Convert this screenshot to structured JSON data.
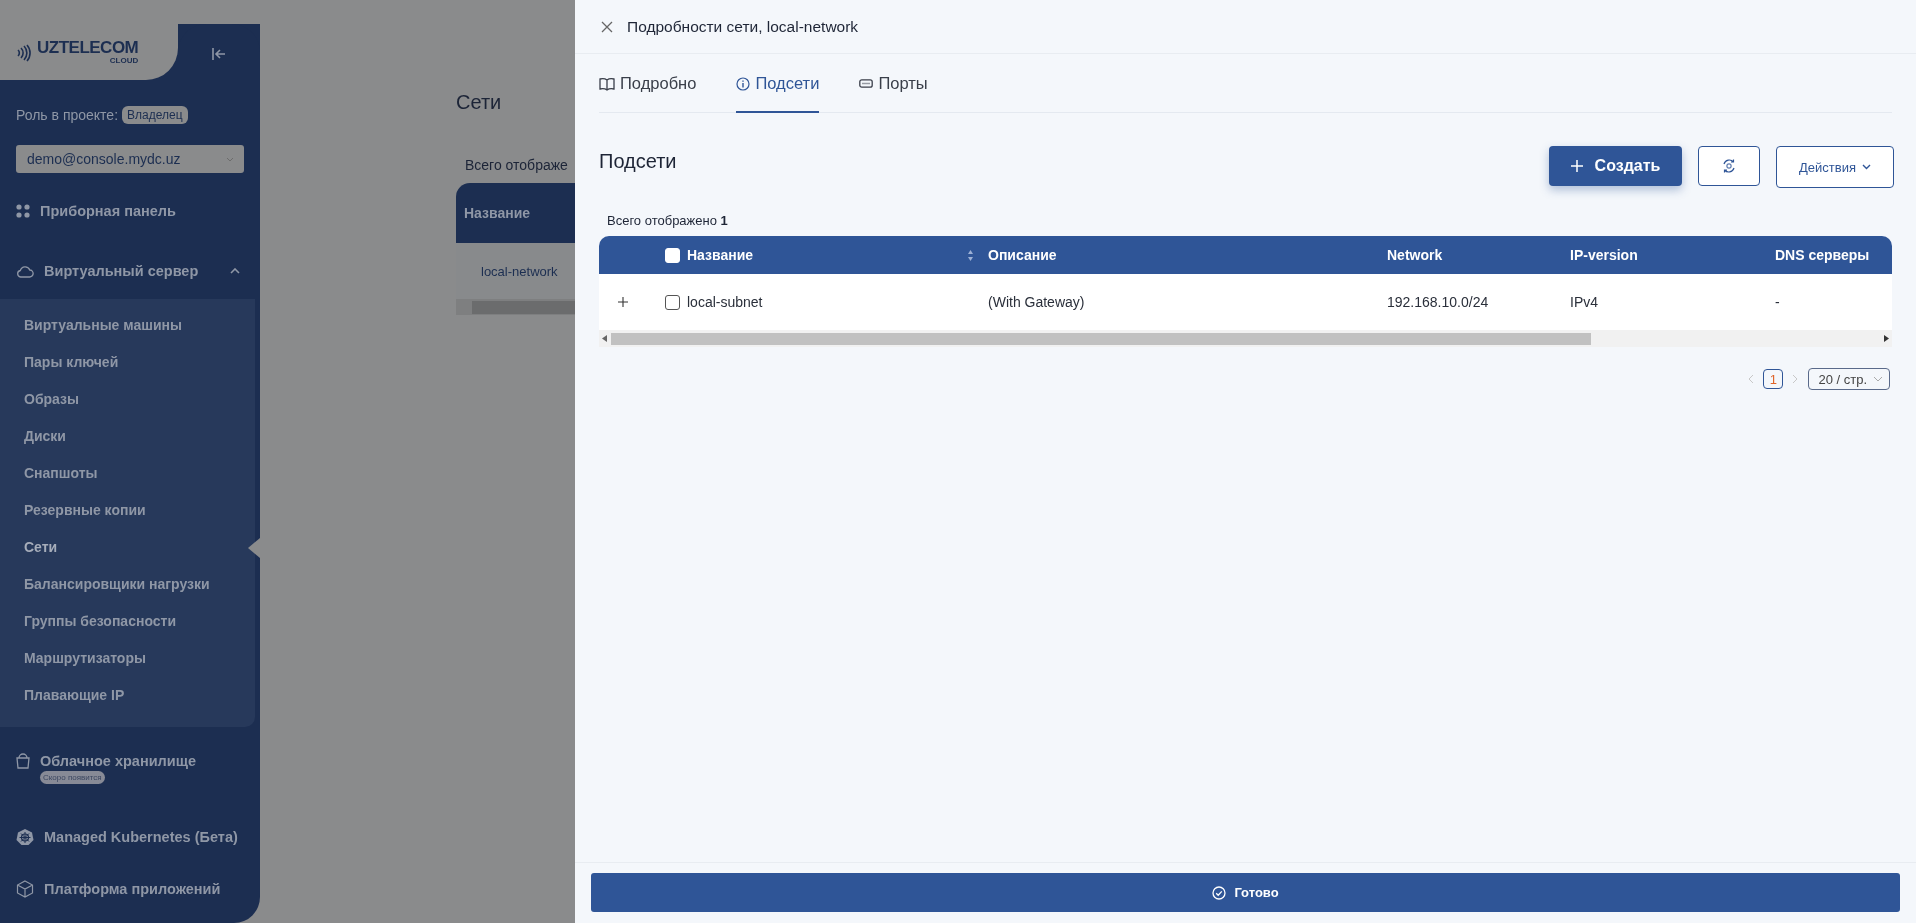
{
  "sidebar": {
    "logo": {
      "name": "UZTELECOM",
      "sub": "CLOUD"
    },
    "role_label": "Роль в проекте:",
    "role_badge": "Владелец",
    "project": "demo@console.mydc.uz",
    "items": [
      {
        "label": "Приборная панель"
      },
      {
        "label": "Виртуальный сервер",
        "expanded": true,
        "children": [
          {
            "label": "Виртуальные машины",
            "selected": false
          },
          {
            "label": "Пары ключей",
            "selected": false
          },
          {
            "label": "Образы",
            "selected": false
          },
          {
            "label": "Диски",
            "selected": false
          },
          {
            "label": "Снапшоты",
            "selected": false
          },
          {
            "label": "Резервные копии",
            "selected": false
          },
          {
            "label": "Сети",
            "selected": true
          },
          {
            "label": "Балансировщики нагрузки",
            "selected": false
          },
          {
            "label": "Группы безопасности",
            "selected": false
          },
          {
            "label": "Маршрутизаторы",
            "selected": false
          },
          {
            "label": "Плавающие IP",
            "selected": false
          }
        ]
      },
      {
        "label": "Облачное хранилище",
        "badge": "Скоро появится"
      },
      {
        "label": "Managed Kubernetes (Бета)"
      },
      {
        "label": "Платформа приложений"
      }
    ]
  },
  "page": {
    "title": "Сети",
    "total": "Всего отображе",
    "columns": [
      "Название"
    ],
    "rows": [
      {
        "name": "local-network"
      }
    ]
  },
  "drawer": {
    "title": "Подробности сети, local-network",
    "tabs": [
      {
        "label": "Подробно",
        "selected": false
      },
      {
        "label": "Подсети",
        "selected": true
      },
      {
        "label": "Порты",
        "selected": false
      }
    ],
    "section_title": "Подсети",
    "create_button": "Создать",
    "actions_button": "Действия",
    "total": {
      "label": "Всего отображено",
      "count": "1"
    },
    "table": {
      "all_checked": false,
      "columns": [
        "Название",
        "Описание",
        "Network",
        "IP-version",
        "DNS серверы"
      ],
      "rows": [
        {
          "expanded": false,
          "checked": false,
          "cells": [
            "local-subnet",
            "(With Gateway)",
            "192.168.10.0/24",
            "IPv4",
            "-"
          ]
        }
      ]
    },
    "pagination": {
      "page": "1",
      "page_size": "20 / стр."
    },
    "done_button": "Готово"
  }
}
